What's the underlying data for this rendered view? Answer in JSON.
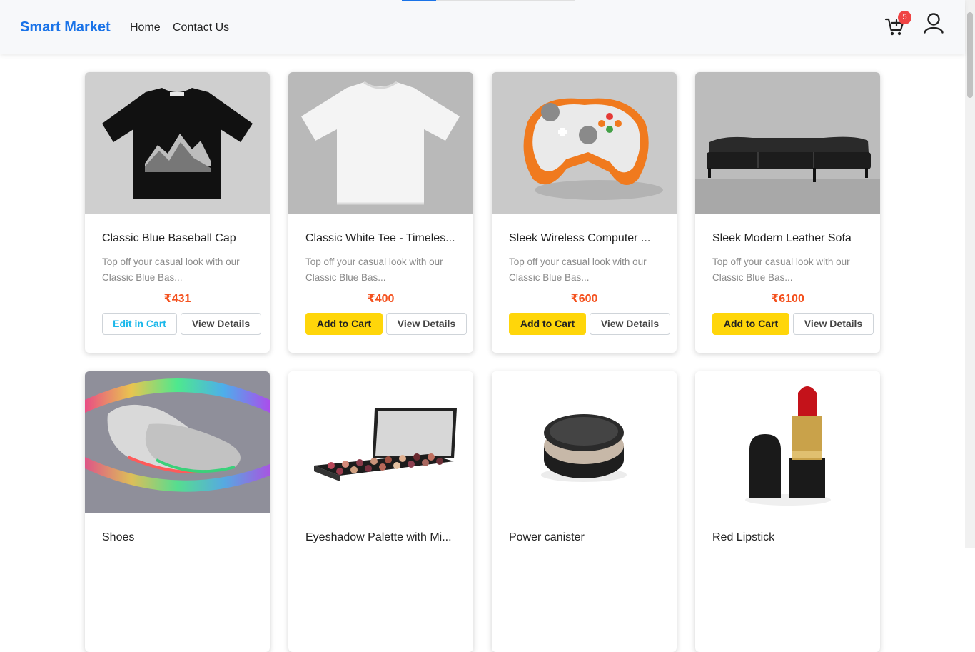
{
  "header": {
    "brand": "Smart Market",
    "nav": [
      "Home",
      "Contact Us"
    ],
    "cart_count": "5",
    "cart_icon": "cart-icon",
    "user_icon": "user-icon",
    "progress": 0.2,
    "colors": {
      "brand": "#1a73e8",
      "badge": "#ef4444",
      "add_button": "#ffd60a",
      "price": "#f4511e",
      "edit_text": "#1ab7ea"
    }
  },
  "products": [
    {
      "title": "Classic Blue Baseball Cap",
      "description": "Top off your casual look with our Classic Blue Bas...",
      "price": "₹431",
      "primary_label": "Edit in Cart",
      "secondary_label": "View Details"
    },
    {
      "title": "Classic White Tee - Timeles...",
      "description": "Top off your casual look with our Classic Blue Bas...",
      "price": "₹400",
      "primary_label": "Add to Cart",
      "secondary_label": "View Details"
    },
    {
      "title": "Sleek Wireless Computer ...",
      "description": "Top off your casual look with our Classic Blue Bas...",
      "price": "₹600",
      "primary_label": "Add to Cart",
      "secondary_label": "View Details"
    },
    {
      "title": "Sleek Modern Leather Sofa",
      "description": "Top off your casual look with our Classic Blue Bas...",
      "price": "₹6100",
      "primary_label": "Add to Cart",
      "secondary_label": "View Details"
    },
    {
      "title": "Shoes"
    },
    {
      "title": "Eyeshadow Palette with Mi..."
    },
    {
      "title": "Power canister"
    },
    {
      "title": "Red Lipstick"
    }
  ]
}
